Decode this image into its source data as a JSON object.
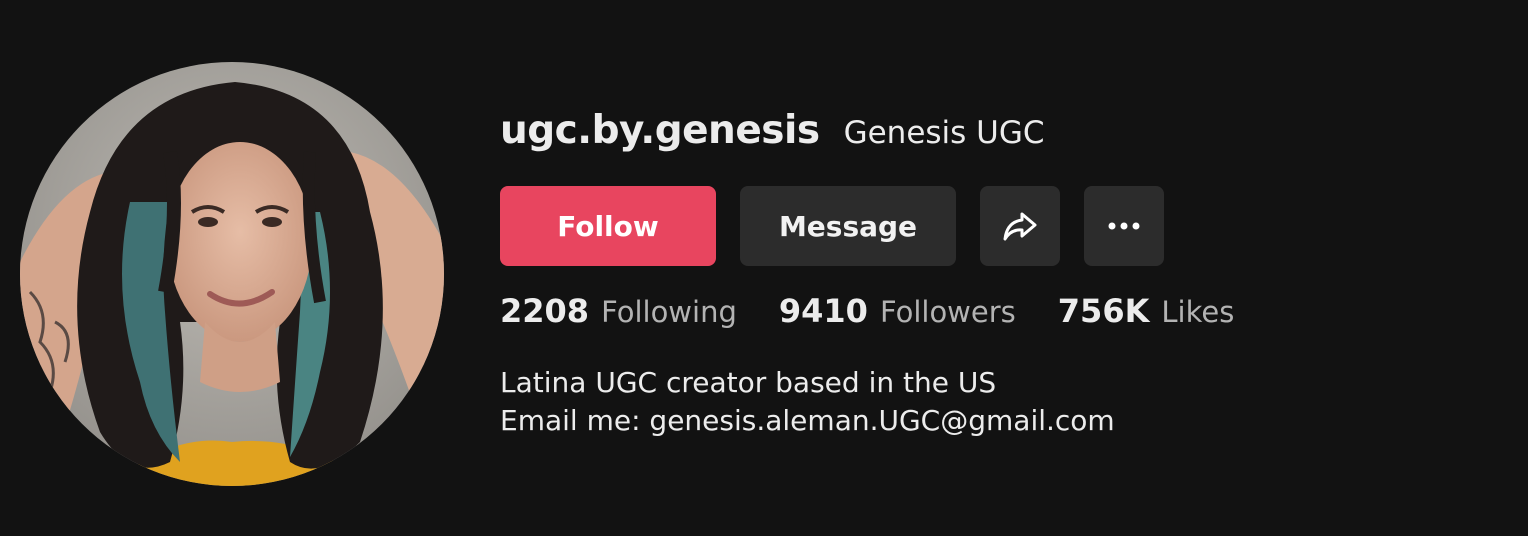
{
  "profile": {
    "username": "ugc.by.genesis",
    "display_name": "Genesis UGC",
    "avatar_alt": "profile-photo"
  },
  "actions": {
    "follow_label": "Follow",
    "message_label": "Message",
    "share_icon": "share-arrow-icon",
    "more_icon": "more-dots-icon"
  },
  "stats": {
    "following_count": "2208",
    "following_label": "Following",
    "followers_count": "9410",
    "followers_label": "Followers",
    "likes_count": "756K",
    "likes_label": "Likes"
  },
  "bio": {
    "line1": "Latina UGC creator based in the US",
    "line2": "Email me: genesis.aleman.UGC@gmail.com"
  },
  "colors": {
    "background": "#121212",
    "follow_button": "#e8455f",
    "secondary_button": "#2c2c2c"
  }
}
